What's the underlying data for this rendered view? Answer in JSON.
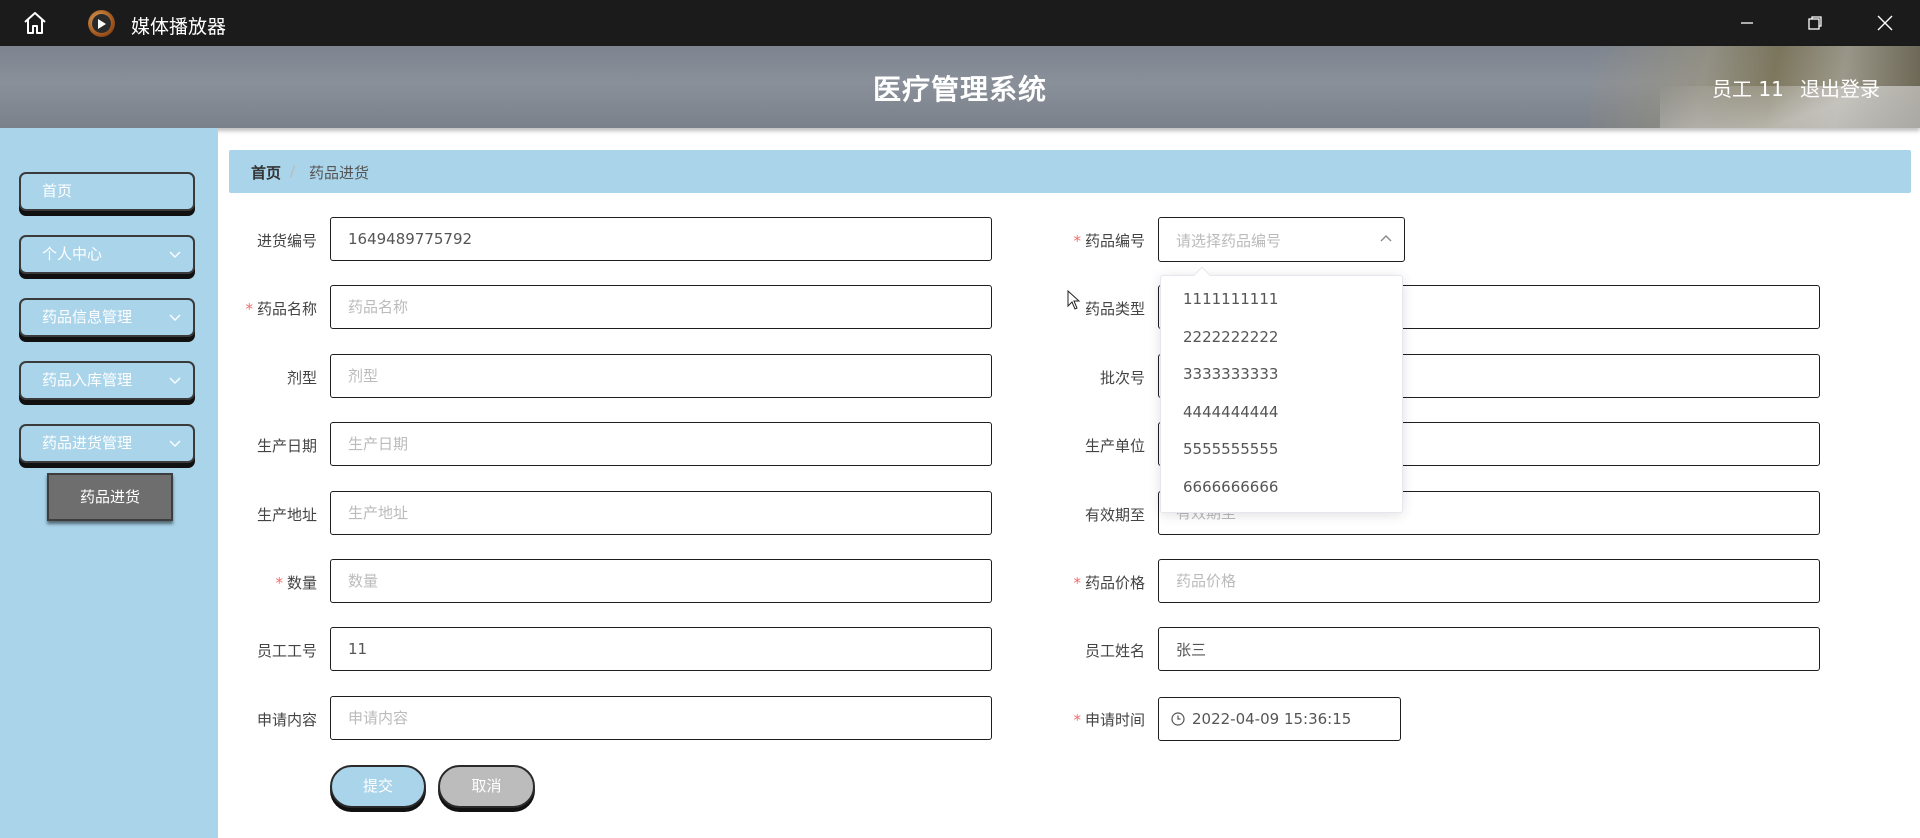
{
  "titlebar": {
    "app_title": "媒体播放器"
  },
  "header": {
    "system_title": "医疗管理系统",
    "user": "员工 11",
    "logout": "退出登录"
  },
  "sidebar": {
    "items": [
      {
        "label": "首页",
        "has_chevron": false
      },
      {
        "label": "个人中心",
        "has_chevron": true
      },
      {
        "label": "药品信息管理",
        "has_chevron": true
      },
      {
        "label": "药品入库管理",
        "has_chevron": true
      },
      {
        "label": "药品进货管理",
        "has_chevron": true
      }
    ],
    "subitem": "药品进货"
  },
  "breadcrumb": {
    "home": "首页",
    "separator": "/",
    "current": "药品进货"
  },
  "form": {
    "left": [
      {
        "label": "进货编号",
        "required": false,
        "value": "1649489775792",
        "placeholder": ""
      },
      {
        "label": "药品名称",
        "required": true,
        "value": "",
        "placeholder": "药品名称"
      },
      {
        "label": "剂型",
        "required": false,
        "value": "",
        "placeholder": "剂型"
      },
      {
        "label": "生产日期",
        "required": false,
        "value": "",
        "placeholder": "生产日期"
      },
      {
        "label": "生产地址",
        "required": false,
        "value": "",
        "placeholder": "生产地址"
      },
      {
        "label": "数量",
        "required": true,
        "value": "",
        "placeholder": "数量"
      },
      {
        "label": "员工工号",
        "required": false,
        "value": "11",
        "placeholder": ""
      },
      {
        "label": "申请内容",
        "required": false,
        "value": "",
        "placeholder": "申请内容"
      }
    ],
    "right": [
      {
        "label": "药品编号",
        "required": true
      },
      {
        "label": "药品类型",
        "required": false,
        "value": "",
        "placeholder": ""
      },
      {
        "label": "批次号",
        "required": false,
        "value": "",
        "placeholder": ""
      },
      {
        "label": "生产单位",
        "required": false,
        "value": "",
        "placeholder": ""
      },
      {
        "label": "有效期至",
        "required": false,
        "value": "",
        "placeholder": "有效期至"
      },
      {
        "label": "药品价格",
        "required": true,
        "value": "",
        "placeholder": "药品价格"
      },
      {
        "label": "员工姓名",
        "required": false,
        "value": "张三",
        "placeholder": ""
      },
      {
        "label": "申请时间",
        "required": true
      }
    ],
    "drug_no_select": {
      "placeholder": "请选择药品编号"
    },
    "apply_time": "2022-04-09 15:36:15",
    "dropdown_options": [
      "1111111111",
      "2222222222",
      "3333333333",
      "4444444444",
      "5555555555",
      "6666666666"
    ],
    "submit": "提交",
    "cancel": "取消"
  }
}
